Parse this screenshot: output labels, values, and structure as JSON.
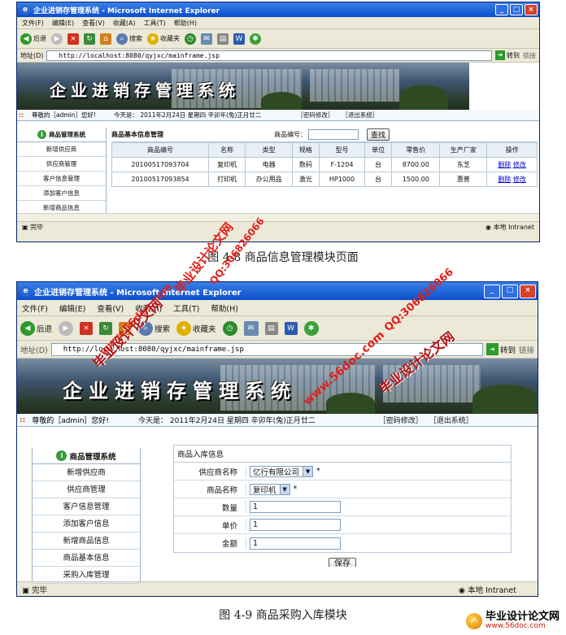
{
  "top": {
    "window_title": "企业进销存管理系统 - Microsoft Internet Explorer",
    "menu": [
      "文件(F)",
      "编辑(E)",
      "查看(V)",
      "收藏(A)",
      "工具(T)",
      "帮助(H)"
    ],
    "toolbar": {
      "back": "后退",
      "search": "搜索",
      "favorites": "收藏夹"
    },
    "address_label": "地址(D)",
    "address_url": "http://localhost:8080/qyjxc/mainframe.jsp",
    "go": "转到",
    "links": "链接",
    "banner_title": "企业进销存管理系统",
    "welcome": "尊敬的［admin］您好!",
    "date": "今天是： 2011年2月24日 星期四 辛卯年(兔)正月廿二",
    "change_pwd": "［密码修改］",
    "logout": "［退出系统］",
    "sidebar_title": "商品管理系统",
    "sidebar_items": [
      "新增供应商",
      "供应商管理",
      "客户信息管理",
      "添加客户信息",
      "新增商品信息"
    ],
    "panel_title": "商品基本信息管理",
    "search_label": "商品编号：",
    "search_button": "查找",
    "columns": [
      "商品编号",
      "名称",
      "类型",
      "规格",
      "型号",
      "单位",
      "零售价",
      "生产厂家",
      "操作"
    ],
    "rows": [
      [
        "20100517093704",
        "复印机",
        "电器",
        "数码",
        "F-1204",
        "台",
        "8700.00",
        "东芝"
      ],
      [
        "20100517093854",
        "打印机",
        "办公用品",
        "激光",
        "HP1000",
        "台",
        "1500.00",
        "惠普"
      ]
    ],
    "delete": "删除",
    "edit": "修改",
    "status_done": "完毕",
    "status_zone": "本地 Intranet",
    "caption": "图 4-8  商品信息管理模块页面"
  },
  "bottom": {
    "window_title": "企业进销存管理系统 - Microsoft Internet Explorer",
    "menu": [
      "文件(F)",
      "编辑(E)",
      "查看(V)",
      "收藏(A)",
      "工具(T)",
      "帮助(H)"
    ],
    "toolbar": {
      "back": "后退",
      "search": "搜索",
      "favorites": "收藏夹"
    },
    "address_label": "地址(D)",
    "address_url": "http://localhost:8080/qyjxc/mainframe.jsp",
    "go": "转到",
    "links": "链接",
    "banner_title": "企业进销存管理系统",
    "welcome": "尊敬的［admin］您好!",
    "date": "今天是： 2011年2月24日 星期四 辛卯年(兔)正月廿二",
    "change_pwd": "［密码修改］",
    "logout": "［退出系统］",
    "sidebar_title": "商品管理系统",
    "sidebar_items": [
      "新增供应商",
      "供应商管理",
      "客户信息管理",
      "添加客户信息",
      "新增商品信息",
      "商品基本信息",
      "采购入库管理"
    ],
    "form_title": "商品入库信息",
    "supplier_label": "供应商名称",
    "supplier_value": "亿行有限公司",
    "product_label": "商品名称",
    "product_value": "复印机",
    "required": "*",
    "qty_label": "数量",
    "qty_value": "1",
    "price_label": "单价",
    "price_value": "1",
    "amount_label": "金额",
    "amount_value": "1",
    "save_button": "保存",
    "status_done": "完毕",
    "status_zone": "本地 Intranet",
    "caption": "图 4-9 商品采购入库模块"
  },
  "watermarks": {
    "brand": "毕业设计论文网",
    "qq": "QQ:306826066",
    "site": "www.56doc.com"
  }
}
